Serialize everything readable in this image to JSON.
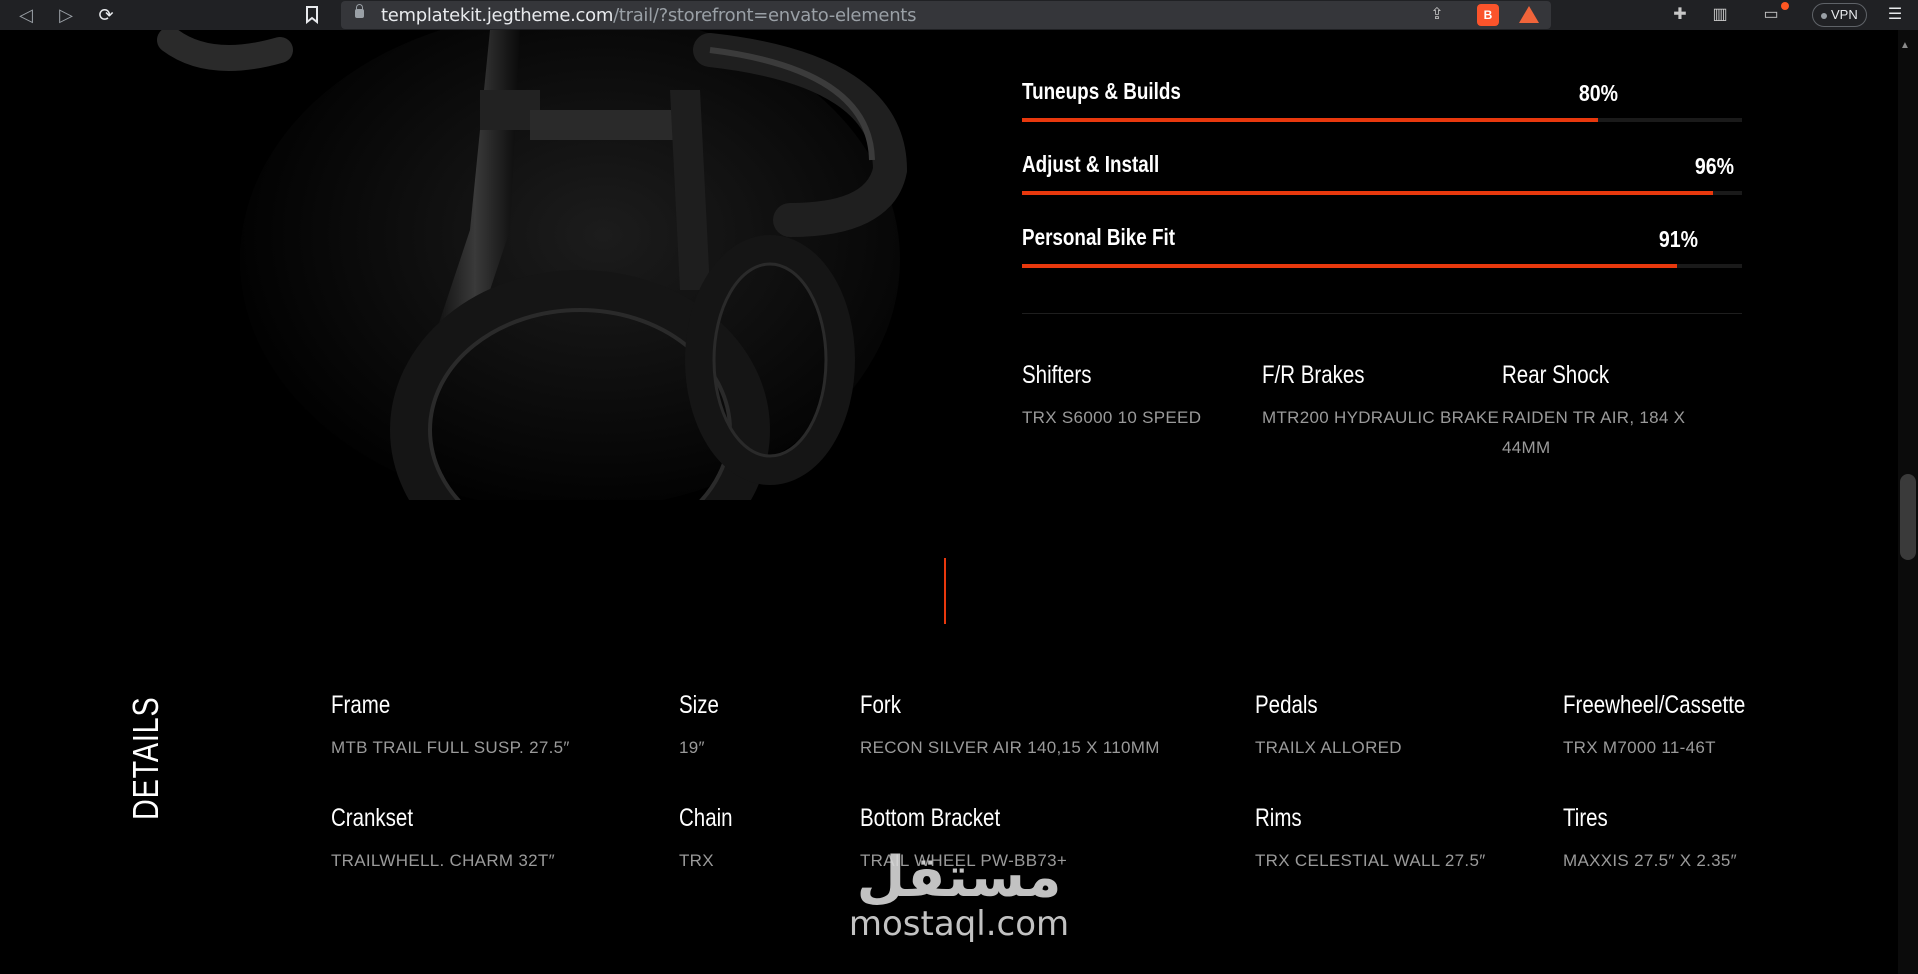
{
  "browser": {
    "url_host": "templatekit.jegtheme.com",
    "url_path": "/trail/?storefront=envato-elements",
    "vpn_label": "VPN"
  },
  "skills": [
    {
      "name": "Tuneups & Builds",
      "percent_label": "80%",
      "percent": 80
    },
    {
      "name": "Adjust & Install",
      "percent_label": "96%",
      "percent": 96
    },
    {
      "name": "Personal Bike Fit",
      "percent_label": "91%",
      "percent": 91
    }
  ],
  "specs": [
    {
      "title": "Shifters",
      "value": "TRX S6000 10 SPEED"
    },
    {
      "title": "F/R Brakes",
      "value": "MTR200 HYDRAULIC BRAKE"
    },
    {
      "title": "Rear Shock",
      "value": "RAIDEN TR AIR, 184 X 44MM"
    }
  ],
  "details": {
    "heading": "DETAILS",
    "items": [
      {
        "title": "Frame",
        "value": "MTB TRAIL FULL SUSP. 27.5″"
      },
      {
        "title": "Size",
        "value": "19″"
      },
      {
        "title": "Fork",
        "value": "RECON SILVER AIR 140,15 X 110MM"
      },
      {
        "title": "Pedals",
        "value": "TRAILX ALLORED"
      },
      {
        "title": "Freewheel/Cassette",
        "value": "TRX M7000 11-46T"
      },
      {
        "title": "Crankset",
        "value": "TRAILWHELL. CHARM 32T″"
      },
      {
        "title": "Chain",
        "value": "TRX"
      },
      {
        "title": "Bottom Bracket",
        "value": "TRAIL WHEEL PW-BB73+"
      },
      {
        "title": "Rims",
        "value": "TRX CELESTIAL WALL 27.5″"
      },
      {
        "title": "Tires",
        "value": "MAXXIS 27.5″ X 2.35″"
      }
    ]
  },
  "watermark": {
    "arabic": "مستقل",
    "latin": "mostaql.com"
  },
  "colors": {
    "accent": "#e8380d",
    "background": "#000000"
  }
}
